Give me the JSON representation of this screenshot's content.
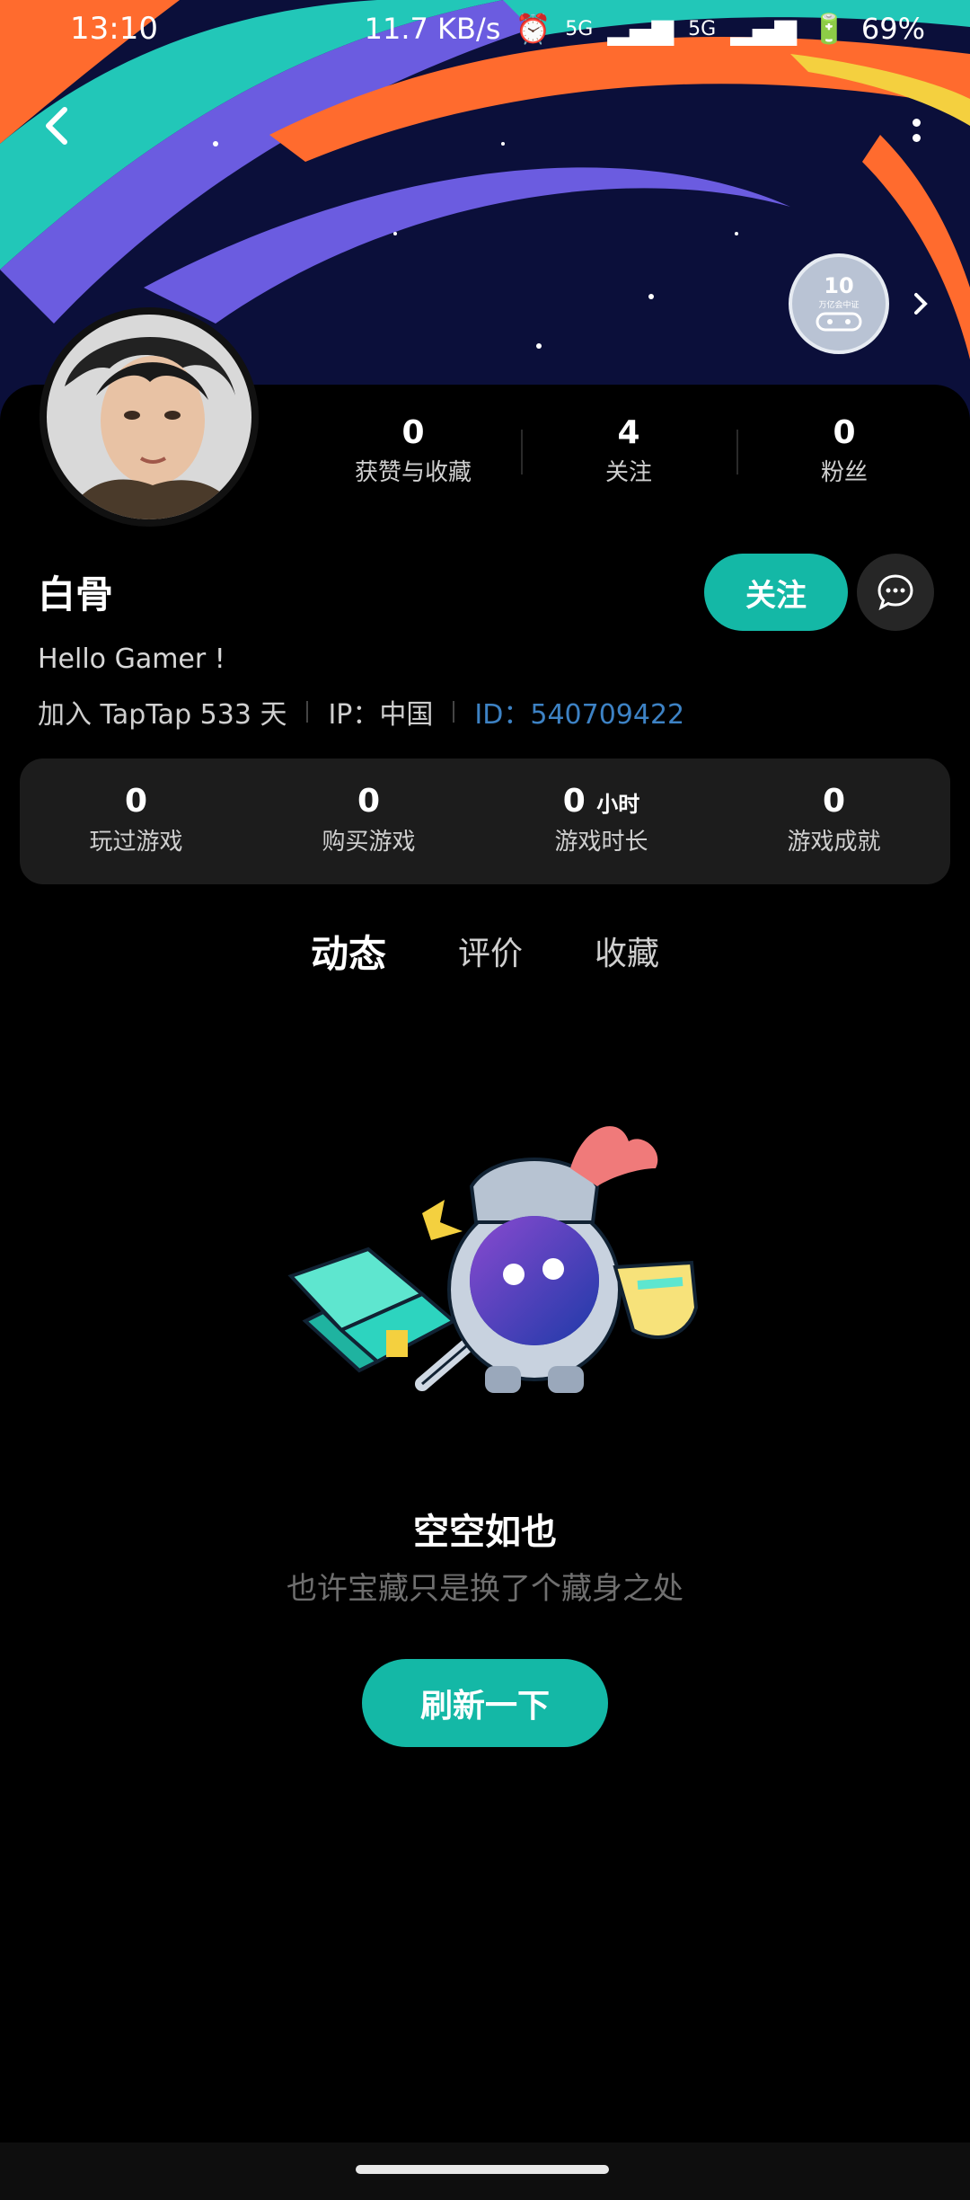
{
  "status_bar": {
    "time": "13:10",
    "net_speed": "11.7 KB/s",
    "net1": "5G",
    "net2": "5G",
    "battery": "69%"
  },
  "badge": {
    "number": "10",
    "caption": "万亿会中证"
  },
  "profile": {
    "name": "白骨",
    "bio": "Hello Gamer !",
    "joined": "加入 TapTap 533 天",
    "ip": "IP：中国",
    "id": "ID：540709422",
    "follow_label": "关注"
  },
  "counts": [
    {
      "value": "0",
      "label": "获赞与收藏"
    },
    {
      "value": "4",
      "label": "关注"
    },
    {
      "value": "0",
      "label": "粉丝"
    }
  ],
  "stats": [
    {
      "value": "0",
      "unit": "",
      "label": "玩过游戏"
    },
    {
      "value": "0",
      "unit": "",
      "label": "购买游戏"
    },
    {
      "value": "0",
      "unit": "小时",
      "label": "游戏时长"
    },
    {
      "value": "0",
      "unit": "",
      "label": "游戏成就"
    }
  ],
  "tabs": [
    {
      "label": "动态",
      "active": true
    },
    {
      "label": "评价",
      "active": false
    },
    {
      "label": "收藏",
      "active": false
    }
  ],
  "empty": {
    "title": "空空如也",
    "subtitle": "也许宝藏只是换了个藏身之处",
    "refresh_label": "刷新一下"
  },
  "colors": {
    "accent": "#14b8a6",
    "id_link": "#3d82c4",
    "banner_bg": "#0b0f3a"
  }
}
